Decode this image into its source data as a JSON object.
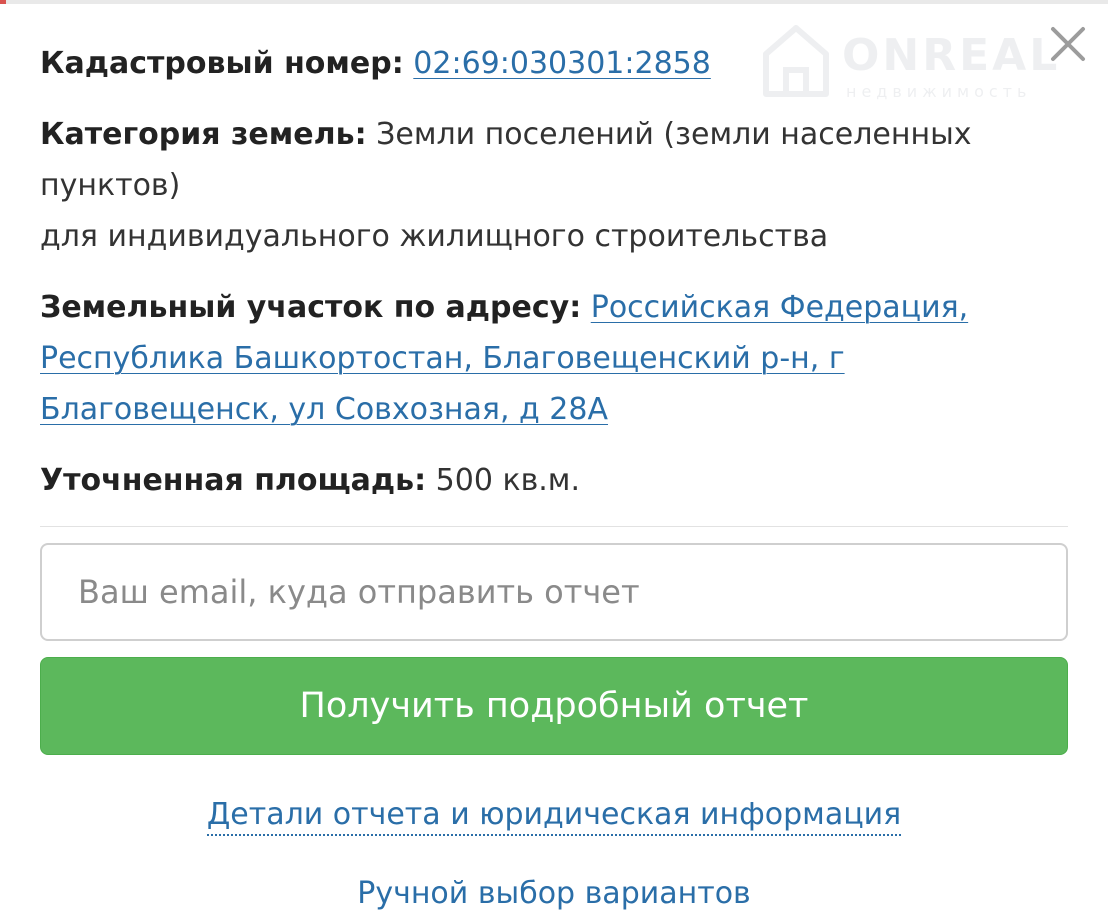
{
  "watermark": {
    "brand": "ONREAL",
    "subtitle": "недвижимость"
  },
  "info": {
    "cadastral_label": "Кадастровый номер:",
    "cadastral_number": "02:69:030301:2858",
    "category_label": "Категория земель:",
    "category_value": "Земли поселений (земли населенных пунктов)",
    "permitted_use": "для индивидуального жилищного строительства",
    "address_label": "Земельный участок по адресу:",
    "address_value": "Российская Федерация, Республика Башкортостан, Благовещенский р-н, г Благовещенск, ул Совхозная, д 28А",
    "area_label": "Уточненная площадь:",
    "area_value": "500 кв.м."
  },
  "form": {
    "email_value": "",
    "email_placeholder": "Ваш email, куда отправить отчет",
    "submit_label": "Получить подробный отчет"
  },
  "links": {
    "details": "Детали отчета и юридическая информация",
    "manual": "Ручной выбор вариантов"
  },
  "icons": {
    "close": "close-icon",
    "watermark": "house-logo-icon"
  },
  "colors": {
    "link": "#2a6ea8",
    "button": "#5cb85c",
    "button_text": "#ffffff",
    "label": "#222222"
  }
}
